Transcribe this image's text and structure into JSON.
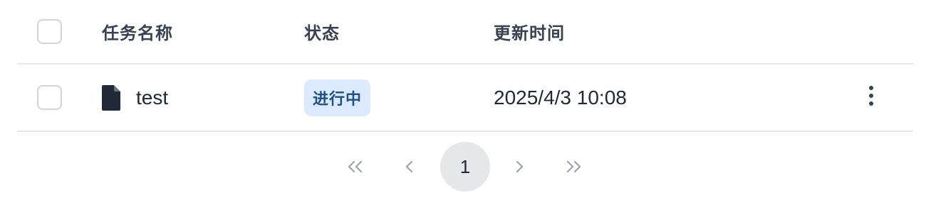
{
  "table": {
    "headers": {
      "name": "任务名称",
      "status": "状态",
      "updated": "更新时间"
    },
    "rows": [
      {
        "name": "test",
        "icon": "file-icon",
        "status": "进行中",
        "updated": "2025/4/3 10:08"
      }
    ]
  },
  "pagination": {
    "current_page": "1",
    "icons": [
      "double-chevron-left-icon",
      "chevron-left-icon",
      "chevron-right-icon",
      "double-chevron-right-icon"
    ]
  },
  "colors": {
    "status_badge_bg": "#dbeafe",
    "status_badge_text": "#1e4f85",
    "divider": "#e5e7eb",
    "current_page_bg": "#e5e7eb"
  }
}
